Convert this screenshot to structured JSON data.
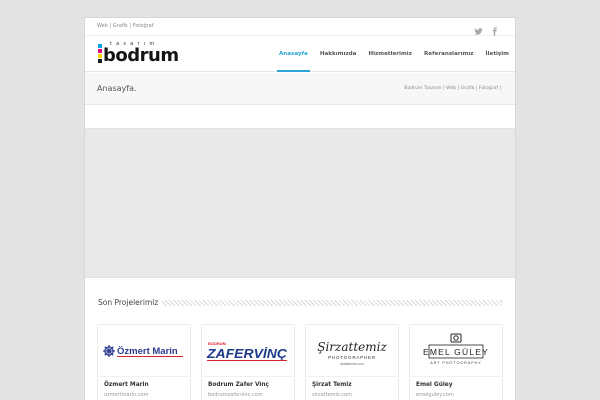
{
  "topbar": {
    "tagline": "Web | Grafik | Fotoğraf"
  },
  "social": [
    {
      "icon": "twitter-icon"
    },
    {
      "icon": "facebook-icon"
    }
  ],
  "logo": {
    "word": "bodrum",
    "small": "tasarım",
    "colors": [
      "#00a0e3",
      "#e5007e",
      "#ffd500",
      "#1a1a1a"
    ]
  },
  "nav": [
    {
      "label": "Anasayfa",
      "active": true
    },
    {
      "label": "Hakkımızda"
    },
    {
      "label": "Hizmetlerimiz"
    },
    {
      "label": "Referanslarımız"
    },
    {
      "label": "İletişim"
    }
  ],
  "titlebar": {
    "title": "Anasayfa.",
    "breadcrumb": "Bodrum Tasarım | Web | Grafik | Fotoğraf |"
  },
  "section": {
    "title": "Son Projelerimiz"
  },
  "projects": [
    {
      "name": "Özmert Marin",
      "url": "ozmertmarin.com",
      "logo_text": "Özmert Marin",
      "logo_color": "#2b3a8f"
    },
    {
      "name": "Bodrum Zafer Vinç",
      "url": "bodrumzafervinc.com",
      "logo_text": "ZAFERVİNÇ",
      "logo_small": "BODRUM",
      "logo_color": "#1f3b8c",
      "accent": "#d9232d"
    },
    {
      "name": "Şirzat Temiz",
      "url": "sirzattemiz.com",
      "logo_text": "Şirzattemiz",
      "logo_small": "PHOTOGRAPHER"
    },
    {
      "name": "Emel Güley",
      "url": "emelguley.com",
      "logo_text": "EMEL GÜLEY",
      "logo_small": "ART PHOTOGRAPHY"
    }
  ]
}
